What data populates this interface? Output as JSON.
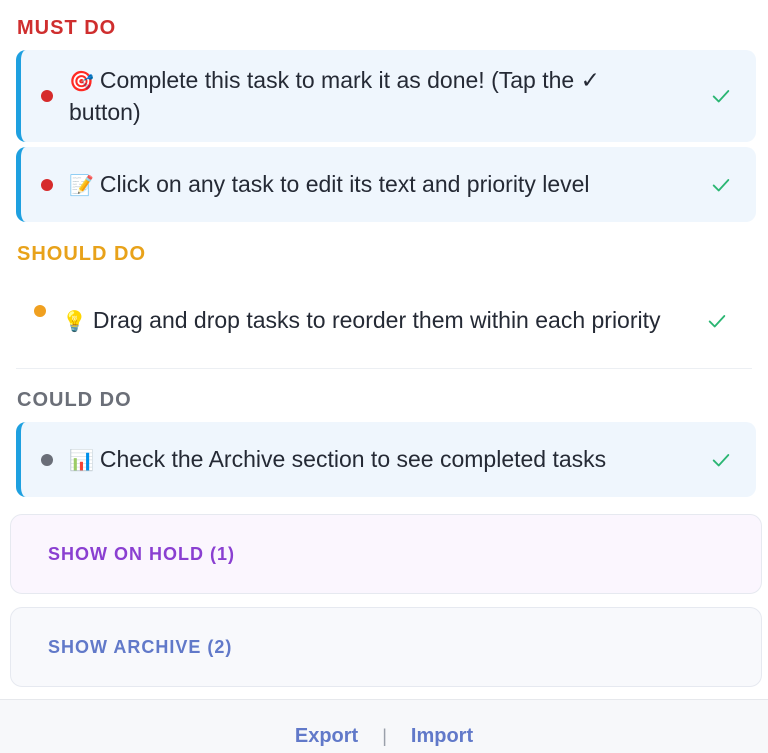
{
  "sections": {
    "must": "MUST DO",
    "should": "SHOULD DO",
    "could": "COULD DO"
  },
  "tasks": [
    {
      "emoji": "🎯",
      "text": "Complete this task to mark it as done! (Tap the ✓ button)",
      "priority": "must",
      "dot_color": "#d62b2b"
    },
    {
      "emoji": "📝",
      "text": "Click on any task to edit its text and priority level",
      "priority": "must",
      "dot_color": "#d62b2b"
    },
    {
      "emoji": "💡",
      "text": "Drag and drop tasks to reorder them within each priority",
      "priority": "should",
      "dot_color": "#f0a020"
    },
    {
      "emoji": "📊",
      "text": "Check the Archive section to see completed tasks",
      "priority": "could",
      "dot_color": "#6a6e78"
    }
  ],
  "panels": {
    "on_hold": "SHOW ON HOLD (1)",
    "archive": "SHOW ARCHIVE (2)"
  },
  "footer": {
    "export": "Export",
    "separator": "|",
    "import": "Import"
  },
  "colors": {
    "accent": "#1ea0e0",
    "check": "#2bb673",
    "must": "#cf2e2e",
    "should": "#e8a21a",
    "could": "#6b6f78",
    "hold": "#8a3fd1",
    "archive": "#6179c9"
  },
  "icons": {
    "complete": "check-icon"
  }
}
